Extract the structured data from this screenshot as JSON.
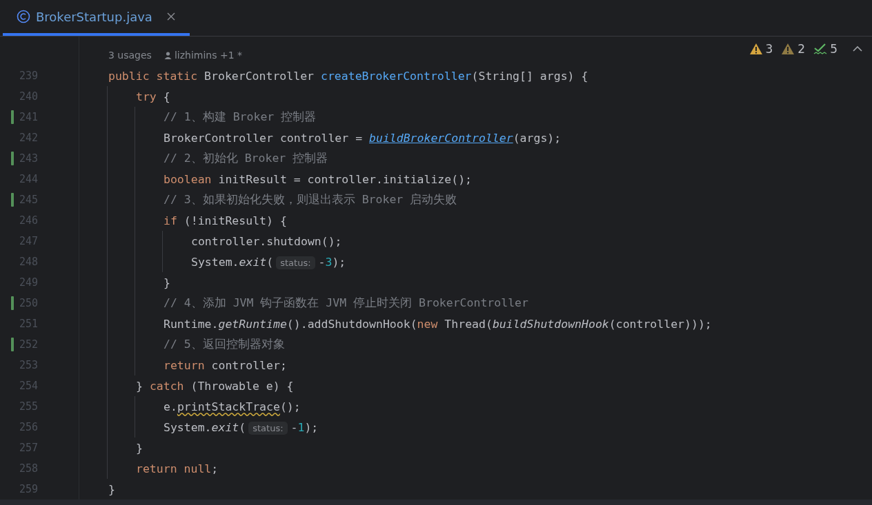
{
  "tab": {
    "title": "BrokerStartup.java",
    "selected": true
  },
  "inspections": [
    {
      "kind": "warning",
      "count": "3"
    },
    {
      "kind": "weak-warning",
      "count": "2"
    },
    {
      "kind": "typo",
      "count": "5"
    }
  ],
  "lens": {
    "usages": "3 usages",
    "author": "lizhimins +1 *"
  },
  "lines": [
    {
      "number": "239",
      "changed": false,
      "tokens": [
        {
          "kind": "kw",
          "text": "public static "
        },
        {
          "kind": "plain",
          "text": "BrokerController "
        },
        {
          "kind": "decl",
          "text": "createBrokerController"
        },
        {
          "kind": "plain",
          "text": "(String[] args) {"
        }
      ],
      "children": [
        {
          "number": "240",
          "changed": false,
          "tokens": [
            {
              "kind": "kw",
              "text": "try"
            },
            {
              "kind": "plain",
              "text": " {"
            }
          ],
          "children": [
            {
              "number": "241",
              "changed": true,
              "tokens": [
                {
                  "kind": "comment",
                  "text": "// 1、构建 Broker 控制器"
                }
              ]
            },
            {
              "number": "242",
              "changed": false,
              "tokens": [
                {
                  "kind": "plain",
                  "text": "BrokerController controller = "
                },
                {
                  "kind": "link",
                  "text": "buildBrokerController"
                },
                {
                  "kind": "plain",
                  "text": "(args);"
                }
              ]
            },
            {
              "number": "243",
              "changed": true,
              "tokens": [
                {
                  "kind": "comment",
                  "text": "// 2、初始化 Broker 控制器"
                }
              ]
            },
            {
              "number": "244",
              "changed": false,
              "tokens": [
                {
                  "kind": "kw",
                  "text": "boolean"
                },
                {
                  "kind": "plain",
                  "text": " initResult = controller.initialize();"
                }
              ]
            },
            {
              "number": "245",
              "changed": true,
              "tokens": [
                {
                  "kind": "comment",
                  "text": "// 3、如果初始化失败，则退出表示 Broker 启动失败"
                }
              ]
            },
            {
              "number": "246",
              "changed": false,
              "tokens": [
                {
                  "kind": "kw",
                  "text": "if"
                },
                {
                  "kind": "plain",
                  "text": " (!initResult) {"
                }
              ],
              "children": [
                {
                  "number": "247",
                  "changed": false,
                  "tokens": [
                    {
                      "kind": "plain",
                      "text": "controller.shutdown();"
                    }
                  ]
                },
                {
                  "number": "248",
                  "changed": false,
                  "tokens": [
                    {
                      "kind": "plain",
                      "text": "System."
                    },
                    {
                      "kind": "italic",
                      "text": "exit"
                    },
                    {
                      "kind": "plain",
                      "text": "("
                    },
                    {
                      "kind": "hint",
                      "text": "status:"
                    },
                    {
                      "kind": "plain",
                      "text": "-"
                    },
                    {
                      "kind": "number",
                      "text": "3"
                    },
                    {
                      "kind": "plain",
                      "text": ");"
                    }
                  ]
                }
              ]
            },
            {
              "number": "249",
              "changed": false,
              "tokens": [
                {
                  "kind": "plain",
                  "text": "}"
                }
              ]
            },
            {
              "number": "250",
              "changed": true,
              "tokens": [
                {
                  "kind": "comment",
                  "text": "// 4、添加 JVM 钩子函数在 JVM 停止时关闭 BrokerController"
                }
              ]
            },
            {
              "number": "251",
              "changed": false,
              "tokens": [
                {
                  "kind": "plain",
                  "text": "Runtime."
                },
                {
                  "kind": "italic",
                  "text": "getRuntime"
                },
                {
                  "kind": "plain",
                  "text": "().addShutdownHook("
                },
                {
                  "kind": "kw",
                  "text": "new"
                },
                {
                  "kind": "plain",
                  "text": " Thread("
                },
                {
                  "kind": "italic",
                  "text": "buildShutdownHook"
                },
                {
                  "kind": "plain",
                  "text": "(controller)));"
                }
              ]
            },
            {
              "number": "252",
              "changed": true,
              "tokens": [
                {
                  "kind": "comment",
                  "text": "// 5、返回控制器对象"
                }
              ]
            },
            {
              "number": "253",
              "changed": false,
              "tokens": [
                {
                  "kind": "kw",
                  "text": "return"
                },
                {
                  "kind": "plain",
                  "text": " controller;"
                }
              ]
            }
          ]
        },
        {
          "number": "254",
          "changed": false,
          "tokens": [
            {
              "kind": "plain",
              "text": "} "
            },
            {
              "kind": "kw",
              "text": "catch"
            },
            {
              "kind": "plain",
              "text": " (Throwable e) {"
            }
          ],
          "children": [
            {
              "number": "255",
              "changed": false,
              "tokens": [
                {
                  "kind": "plain",
                  "text": "e."
                },
                {
                  "kind": "warn",
                  "text": "printStackTrace"
                },
                {
                  "kind": "plain",
                  "text": "();"
                }
              ]
            },
            {
              "number": "256",
              "changed": false,
              "tokens": [
                {
                  "kind": "plain",
                  "text": "System."
                },
                {
                  "kind": "italic",
                  "text": "exit"
                },
                {
                  "kind": "plain",
                  "text": "("
                },
                {
                  "kind": "hint",
                  "text": "status:"
                },
                {
                  "kind": "plain",
                  "text": "-"
                },
                {
                  "kind": "number",
                  "text": "1"
                },
                {
                  "kind": "plain",
                  "text": ");"
                }
              ]
            }
          ]
        },
        {
          "number": "257",
          "changed": false,
          "tokens": [
            {
              "kind": "plain",
              "text": "}"
            }
          ]
        },
        {
          "number": "258",
          "changed": false,
          "tokens": [
            {
              "kind": "kw",
              "text": "return null"
            },
            {
              "kind": "plain",
              "text": ";"
            }
          ]
        }
      ]
    },
    {
      "number": "259",
      "changed": false,
      "tokens": [
        {
          "kind": "plain",
          "text": "}"
        }
      ]
    }
  ]
}
